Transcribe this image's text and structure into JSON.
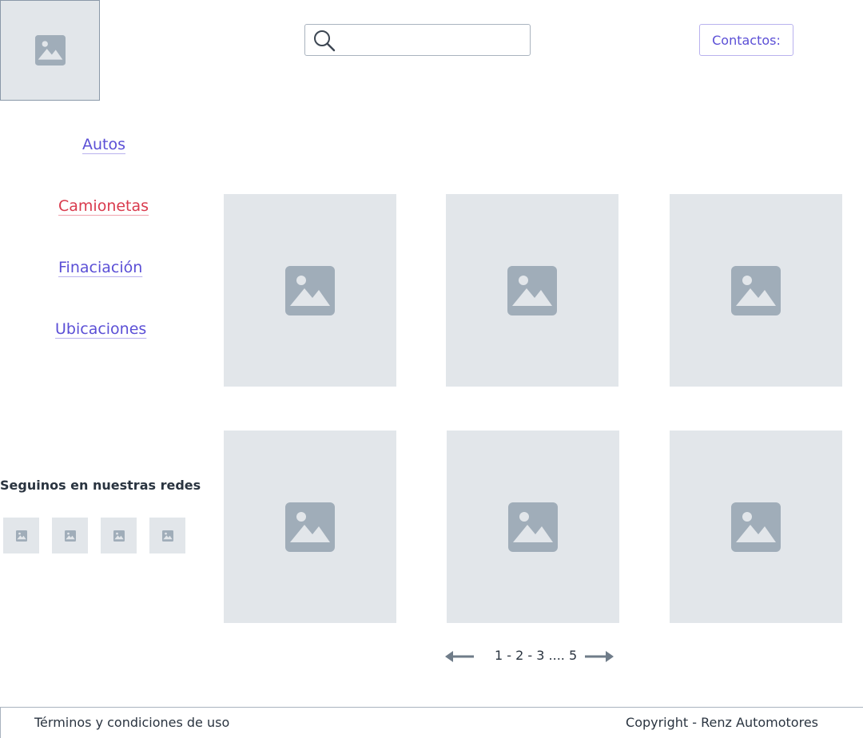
{
  "header": {
    "logo_icon": "image-placeholder-icon",
    "search": {
      "value": "",
      "placeholder": "",
      "icon": "search-icon"
    },
    "contact_label": "Contactos:"
  },
  "nav": {
    "items": [
      {
        "label": "Autos",
        "active": false
      },
      {
        "label": "Camionetas",
        "active": true
      },
      {
        "label": "Finaciación",
        "active": false
      },
      {
        "label": "Ubicaciones",
        "active": false
      }
    ]
  },
  "social": {
    "title": "Seguinos en nuestras redes",
    "icons": [
      "image-placeholder-icon",
      "image-placeholder-icon",
      "image-placeholder-icon",
      "image-placeholder-icon"
    ]
  },
  "grid": {
    "cards": [
      "image-placeholder-icon",
      "image-placeholder-icon",
      "image-placeholder-icon",
      "image-placeholder-icon",
      "image-placeholder-icon",
      "image-placeholder-icon"
    ]
  },
  "pagination": {
    "text": "1 - 2 - 3 .... 5",
    "prev_icon": "arrow-left-icon",
    "next_icon": "arrow-right-icon"
  },
  "footer": {
    "terms": "Términos y condiciones de uso",
    "copyright": "Copyright - Renz Automotores"
  },
  "colors": {
    "accent": "#5b4fd6",
    "active": "#d93a4d",
    "placeholder_bg": "#e2e6ea",
    "placeholder_icon": "#a0adb9"
  }
}
